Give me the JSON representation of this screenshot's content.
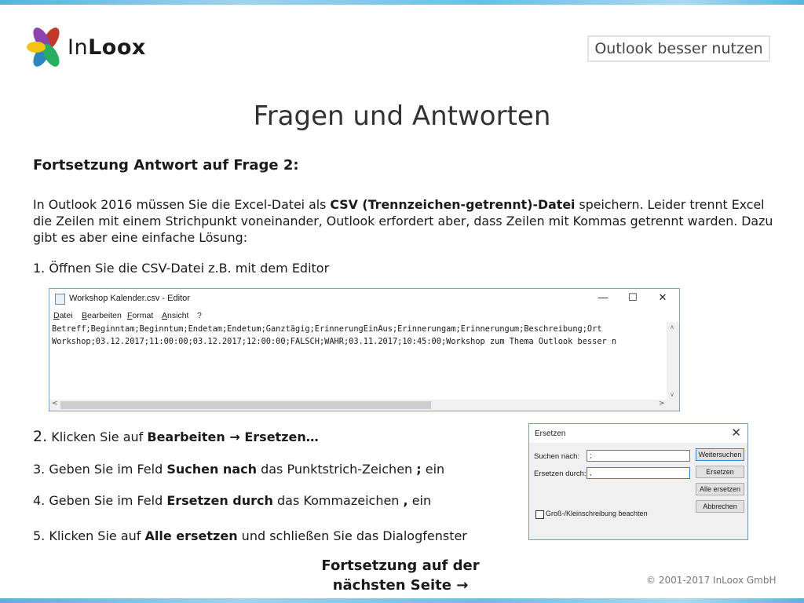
{
  "header": {
    "brand_prefix": "In",
    "brand_suffix": "Loox",
    "slogan": "Outlook besser nutzen"
  },
  "page_title": "Fragen und Antworten",
  "subheading": "Fortsetzung Antwort auf Frage 2:",
  "intro": {
    "part1": "In Outlook 2016 müssen Sie die Excel-Datei als ",
    "bold": "CSV (Trennzeichen-getrennt)-Datei",
    "part2": " speichern. Leider trennt Excel die Zeilen mit einem Strichpunkt voneinander, Outlook erfordert aber, dass Zeilen mit Kommas getrennt warden. Dazu gibt es aber eine einfache Lösung:"
  },
  "steps": {
    "s1": "1. Öffnen Sie die CSV-Datei z.B. mit dem Editor",
    "s2_num": "2.",
    "s2_a": " Klicken Sie auf ",
    "s2_b1": "Bearbeiten",
    "s2_arrow": " → ",
    "s2_b2": "Ersetzen…",
    "s3_a": "3. Geben Sie im Feld ",
    "s3_b": "Suchen nach",
    "s3_c": " das Punktstrich-Zeichen ",
    "s3_d": ";",
    "s3_e": " ein",
    "s4_a": "4. Geben Sie im Feld ",
    "s4_b": "Ersetzen durch",
    "s4_c": " das Kommazeichen ",
    "s4_d": ",",
    "s4_e": " ein",
    "s5_a": "5. Klicken Sie auf ",
    "s5_b": "Alle ersetzen",
    "s5_c": " und schließen Sie das Dialogfenster"
  },
  "notepad": {
    "title": "Workshop Kalender.csv - Editor",
    "menu": [
      "Datei",
      "Bearbeiten",
      "Format",
      "Ansicht",
      "?"
    ],
    "line1": "Betreff;Beginntam;Beginntum;Endetam;Endetum;Ganztägig;ErinnerungEinAus;Erinnerungam;Erinnerungum;Beschreibung;Ort",
    "line2": "Workshop;03.12.2017;11:00:00;03.12.2017;12:00:00;FALSCH;WAHR;03.11.2017;10:45:00;Workshop zum Thema Outlook besser n"
  },
  "dialog": {
    "title": "Ersetzen",
    "find_label": "Suchen nach:",
    "find_value": ";",
    "replace_label": "Ersetzen durch:",
    "replace_value": ",",
    "btn_find_next": "Weitersuchen",
    "btn_replace": "Ersetzen",
    "btn_replace_all": "Alle ersetzen",
    "btn_cancel": "Abbrechen",
    "checkbox_label": "Groß-/Kleinschreibung beachten"
  },
  "continue_text_line1": "Fortsetzung auf der",
  "continue_text_line2": "nächsten Seite →",
  "copyright": "© 2001-2017 InLoox GmbH",
  "colors": {
    "accent_bar": "#6cbde6"
  }
}
